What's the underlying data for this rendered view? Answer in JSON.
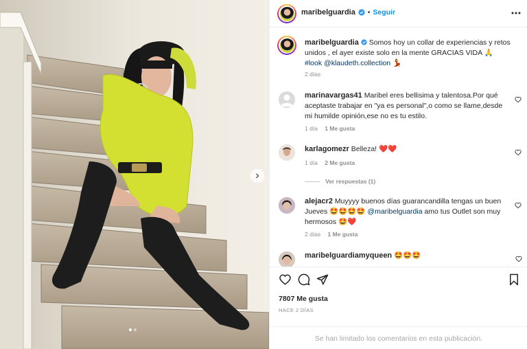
{
  "post": {
    "username": "maribelguardia",
    "follow_label": "Seguir",
    "separator": "•",
    "caption": {
      "username": "maribelguardia",
      "text": "Somos hoy un collar de experiencias y retos unidos , el ayer existe solo en la mente GRACIAS VIDA",
      "emoji1": "🙏",
      "hashtag": "#look",
      "mention": "@klaudeth.collection",
      "emoji2": "💃",
      "time": "2 días"
    }
  },
  "comments": [
    {
      "username": "marinavargas41",
      "text": "Maribel eres bellisima y talentosa.Por qué aceptaste trabajar en \"ya es personal\",o como se llame,desde mi humilde opinión,ese no es tu estilo.",
      "time": "1 día",
      "likes": "1 Me gusta"
    },
    {
      "username": "karlagomezr",
      "text": "Belleza!",
      "emoji": "❤️❤️",
      "time": "1 día",
      "likes": "2 Me gusta",
      "replies": "Ver respuestas (1)"
    },
    {
      "username": "alejacr2",
      "text_a": "Muyyyy buenos días guarancandilla tengas un buen Jueves",
      "emoji_a": "🤩🤩🤩🤩",
      "mention": "@maribelguardia",
      "text_b": "amo tus Outlet son muy hermosos",
      "emoji_b": "🤩❤️",
      "time": "2 días",
      "likes": "1 Me gusta"
    },
    {
      "username": "maribelguardiamyqueen",
      "emoji": "🤩🤩🤩"
    }
  ],
  "footer": {
    "likes": "7807 Me gusta",
    "ago": "HACE 2 DÍAS",
    "limited_notice": "Se han limitado los comentarios en esta publicación."
  },
  "colors": {
    "accent": "#0095f6",
    "verified": "#3897f0",
    "heart": "#ed4956",
    "muted": "#8e8e8e",
    "link": "#00376b"
  },
  "icons": [
    "more-icon",
    "heart-icon",
    "comment-icon",
    "share-icon",
    "bookmark-icon",
    "chevron-right-icon",
    "verified-icon"
  ]
}
